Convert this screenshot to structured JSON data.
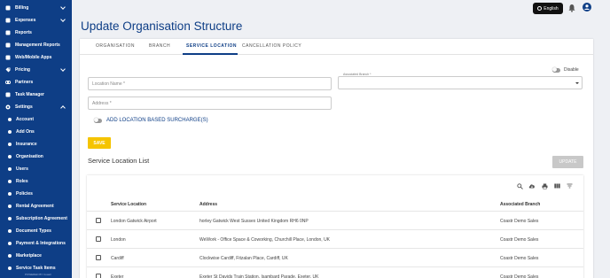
{
  "sidebar": {
    "items": [
      {
        "label": "Billing",
        "icon": "billing-icon",
        "chevron": "down"
      },
      {
        "label": "Expenses",
        "icon": "expenses-icon",
        "chevron": "down"
      },
      {
        "label": "Reports",
        "icon": "reports-icon"
      },
      {
        "label": "Management Reports",
        "icon": "management-reports-icon"
      },
      {
        "label": "Web/Mobile Apps",
        "icon": "apps-icon"
      },
      {
        "label": "Pricing",
        "icon": "pricing-icon",
        "chevron": "down"
      },
      {
        "label": "Partners",
        "icon": "partners-icon"
      },
      {
        "label": "Task Manager",
        "icon": "task-manager-icon"
      },
      {
        "label": "Settings",
        "icon": "settings-gear-icon",
        "chevron": "up"
      }
    ],
    "sub_items": [
      "Account",
      "Add Ons",
      "Insurance",
      "Organisation",
      "Users",
      "Roles",
      "Policies",
      "Rental Agreement",
      "Subscription Agreement",
      "Document Types",
      "Payment & Integrations",
      "Marketplace",
      "Service Task Items"
    ],
    "powered_by": "POWERED BY Coastr"
  },
  "topbar": {
    "language": "English"
  },
  "page": {
    "title": "Update Organisation Structure"
  },
  "tabs": [
    "ORGANISATION",
    "BRANCH",
    "SERVICE LOCATION",
    "CANCELLATION POLICY"
  ],
  "active_tab": "SERVICE LOCATION",
  "form": {
    "disable_label": "Disable",
    "location_name_placeholder": "Location Name *",
    "associated_branch_label": "Associated Branch *",
    "associated_branch_value": "",
    "address_placeholder": "Address *",
    "surcharge_label": "ADD LOCATION BASED SURCHARGE(S)",
    "save_label": "SAVE"
  },
  "list": {
    "title": "Service Location List",
    "update_label": "UPDATE",
    "columns": [
      "Service Location",
      "Address",
      "Associated Branch"
    ],
    "rows": [
      {
        "location": "London Gatwick Airport",
        "address": "horley Gatwick West Sussex United Kingdom RH6 0NP",
        "branch": "Coastr Demo Sales"
      },
      {
        "location": "London",
        "address": "WeWork - Office Space & Coworking, Churchill Place, London, UK",
        "branch": "Coastr Demo Sales"
      },
      {
        "location": "Cardiff",
        "address": "Clockwise Cardiff, Fitzalan Place, Cardiff, UK",
        "branch": "Coastr Demo Sales"
      },
      {
        "location": "Exeter",
        "address": "Exeter St Davids Train Station, Isambard Parade, Exeter, UK",
        "branch": "Coastr Demo Sales"
      }
    ]
  },
  "colors": {
    "sidebar_bg": "#0e3e86",
    "accent": "#0e3e86",
    "save_button": "#f5c400",
    "update_button_disabled": "#c8c8c8"
  }
}
